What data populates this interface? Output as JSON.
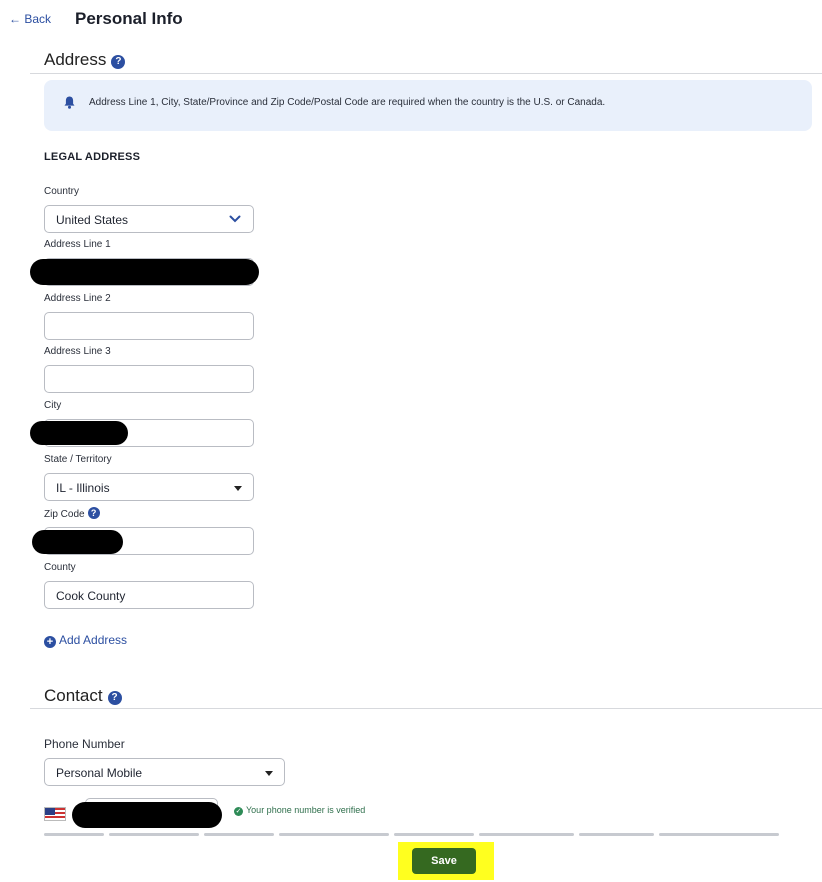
{
  "header": {
    "back_label": "← Back",
    "title": "Personal Info"
  },
  "address": {
    "section_title": "Address",
    "notice": "Address Line 1, City, State/Province and Zip Code/Postal Code are required when the country is the U.S. or Canada.",
    "legal_heading": "LEGAL ADDRESS",
    "country": {
      "label": "Country",
      "value": "United States"
    },
    "line1": {
      "label": "Address Line 1",
      "value": ""
    },
    "line2": {
      "label": "Address Line 2",
      "value": ""
    },
    "line3": {
      "label": "Address Line 3",
      "value": ""
    },
    "city": {
      "label": "City",
      "value": ""
    },
    "state": {
      "label": "State / Territory",
      "value": "IL - Illinois"
    },
    "zip": {
      "label": "Zip Code",
      "value": ""
    },
    "county": {
      "label": "County",
      "value": "Cook County"
    },
    "add_label": "Add Address"
  },
  "contact": {
    "section_title": "Contact",
    "phone_label": "Phone Number",
    "phone_type": "Personal Mobile",
    "phone_value": "",
    "verified_text": "Your phone number is verified"
  },
  "footer": {
    "save_label": "Save"
  },
  "colors": {
    "accent": "#2c4fa1",
    "save": "#356920",
    "highlight": "#ffff1f",
    "notice_bg": "#e9f0fb"
  },
  "icons": [
    "back-arrow-icon",
    "help-icon",
    "bell-icon",
    "chevron-down-icon",
    "caret-down-icon",
    "plus-circle-icon",
    "us-flag-icon",
    "check-circle-icon"
  ]
}
